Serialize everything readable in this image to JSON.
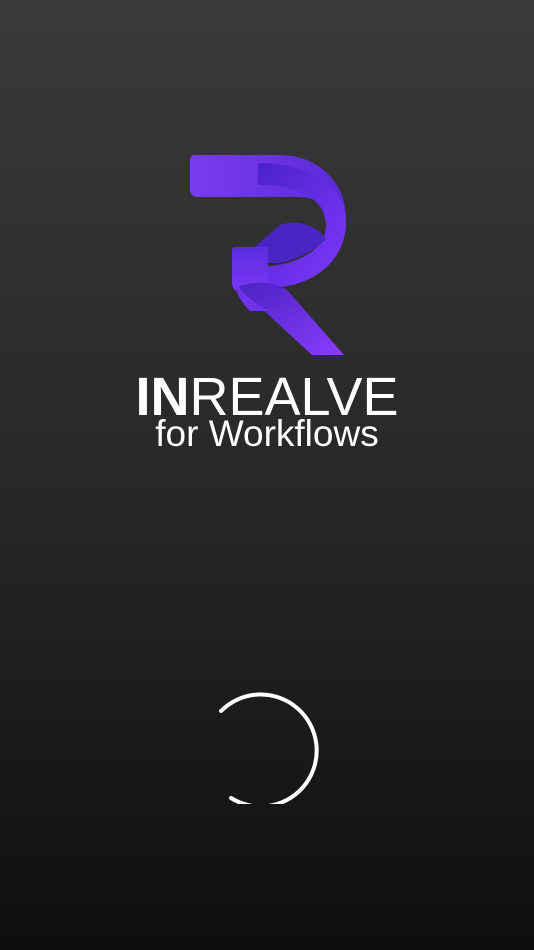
{
  "brand": {
    "name_bold": "IN",
    "name_regular": "REALVE",
    "subtitle": "for Workflows"
  },
  "icons": {
    "logo": "ribbon-r-logo-icon",
    "loader": "loading-spinner-icon"
  },
  "colors": {
    "background_top": "#3a3a3a",
    "background_bottom": "#0e0e0e",
    "logo_primary": "#6a32e8",
    "logo_light": "#8b3dff",
    "logo_dark": "#4020b0",
    "text": "#ffffff",
    "spinner": "#ffffff"
  }
}
